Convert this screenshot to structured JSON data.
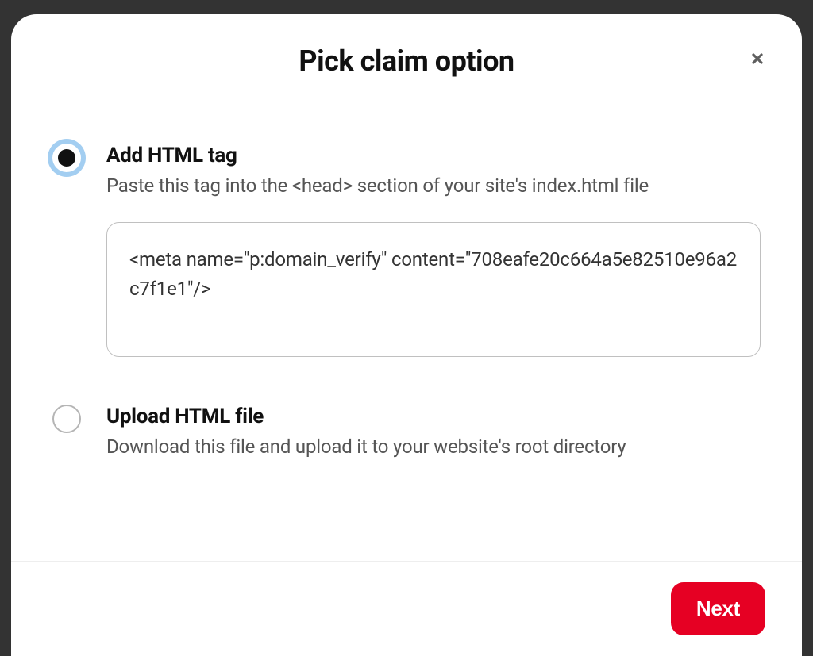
{
  "modal": {
    "title": "Pick claim option",
    "options": {
      "html_tag": {
        "title": "Add HTML tag",
        "description": "Paste this tag into the <head> section of your site's index.html file",
        "code": "<meta name=\"p:domain_verify\" content=\"708eafe20c664a5e82510e96a2c7f1e1\"/>"
      },
      "upload_file": {
        "title": "Upload HTML file",
        "description": "Download this file and upload it to your website's root directory"
      }
    },
    "next_label": "Next"
  }
}
